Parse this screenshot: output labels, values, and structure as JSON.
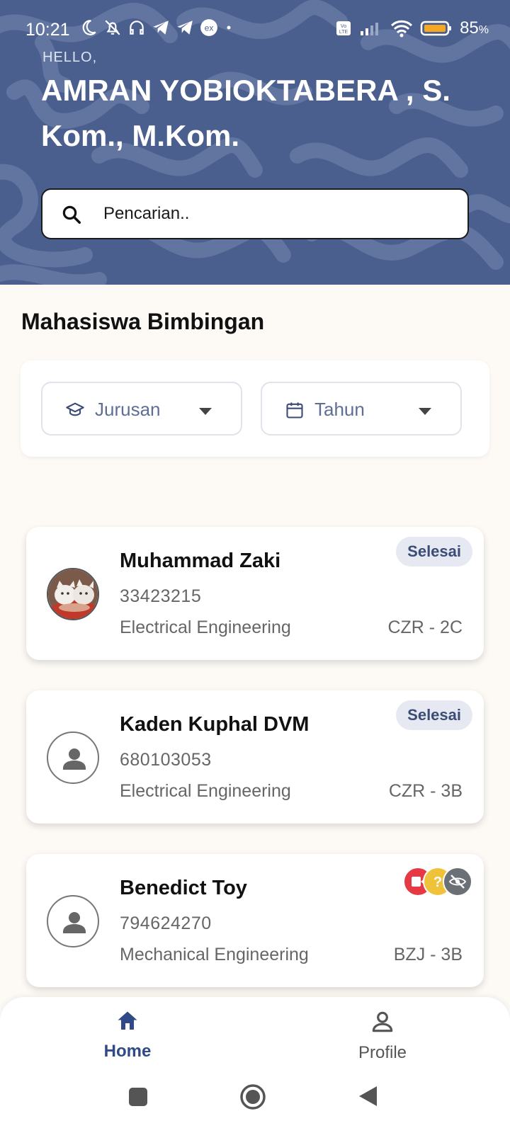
{
  "status_bar": {
    "time": "10:21",
    "battery_percent": "85",
    "battery_suffix": "%",
    "icons_left": [
      "moon-icon",
      "bell-off-icon",
      "headset-icon",
      "telegram-icon",
      "telegram-icon",
      "ex-app-icon",
      "dot-icon"
    ],
    "icons_right": [
      "volte-icon",
      "signal-icon",
      "wifi-icon",
      "battery-icon"
    ]
  },
  "header": {
    "greeting": "HELLO,",
    "name": "AMRAN YOBIOKTABERA , S. Kom., M.Kom.",
    "background_color": "#4b5f8f"
  },
  "search": {
    "placeholder": "Pencarian.."
  },
  "section": {
    "title": "Mahasiswa Bimbingan"
  },
  "filters": {
    "jurusan_label": "Jurusan",
    "tahun_label": "Tahun"
  },
  "students": [
    {
      "name": "Muhammad Zaki",
      "nim": "33423215",
      "department": "Electrical Engineering",
      "class": "CZR - 2C",
      "status": "Selesai",
      "avatar": "photo-cats"
    },
    {
      "name": "Kaden Kuphal DVM",
      "nim": "680103053",
      "department": "Electrical Engineering",
      "class": "CZR - 3B",
      "status": "Selesai",
      "avatar": "person-icon"
    },
    {
      "name": "Benedict Toy",
      "nim": "794624270",
      "department": "Mechanical Engineering",
      "class": "BZJ - 3B",
      "status_icons": [
        "video-icon",
        "question-icon",
        "eye-off-icon"
      ],
      "avatar": "person-icon"
    }
  ],
  "bottom_nav": {
    "home_label": "Home",
    "profile_label": "Profile",
    "active": "Home",
    "accent_color": "#2f4a86"
  },
  "system_nav": [
    "recents-button",
    "home-button",
    "back-button"
  ]
}
